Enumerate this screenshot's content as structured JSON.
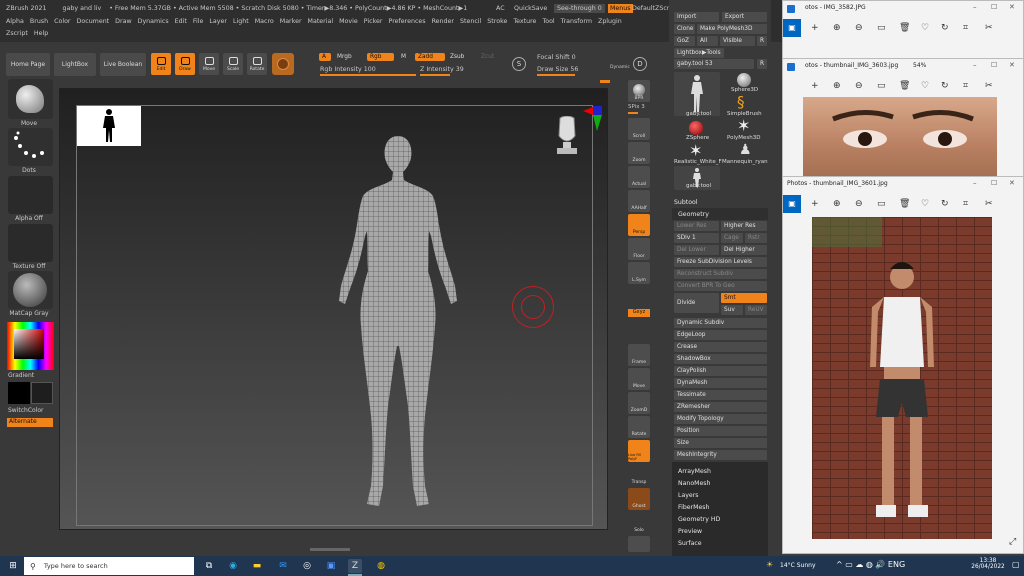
{
  "zbrush": {
    "status_title": "ZBrush 2021",
    "status_project": "gaby and liv",
    "status_mem": "• Free Mem 5.37GB • Active Mem 5508 • Scratch Disk 5080 • Timer▶8.346 • PolyCount▶4.86 KP • MeshCount▶1",
    "ac": "AC",
    "quicksave": "QuickSave",
    "seethrough": "See-through  0",
    "menus": "Menus",
    "defaultzscript": "DefaultZScript",
    "menu_row1": [
      "Alpha",
      "Brush",
      "Color",
      "Document",
      "Draw",
      "Dynamics",
      "Edit",
      "File",
      "Layer",
      "Light",
      "Macro",
      "Marker",
      "Material",
      "Movie",
      "Picker",
      "Preferences",
      "Render",
      "Stencil",
      "Stroke",
      "Texture",
      "Tool",
      "Transform",
      "Zplugin"
    ],
    "menu_row2": [
      "Zscript",
      "Help"
    ],
    "home_page": "Home Page",
    "lightbox": "LightBox",
    "live_boolean": "Live Boolean",
    "tools": {
      "edit": "Edit",
      "draw": "Draw",
      "move": "Move",
      "scale": "Scale",
      "rotate": "Rotate"
    },
    "switches": {
      "a": "A",
      "mrgb": "Mrgb",
      "rgb": "Rgb",
      "m": "M",
      "zadd": "Zadd",
      "zsub": "Zsub",
      "zcut": "Zcut"
    },
    "rgb_intensity": "Rgb Intensity 100",
    "z_intensity": "Z Intensity 39",
    "focal_shift": "Focal Shift 0",
    "draw_size": "Draw Size 56",
    "dynamic": "Dynamic",
    "left": {
      "move": "Move",
      "dots": "Dots",
      "alpha_off": "Alpha Off",
      "texture_off": "Texture Off",
      "matcap_gray": "MatCap Gray",
      "gradient": "Gradient",
      "switchcolor": "SwitchColor",
      "alternate": "Alternate"
    },
    "shelf": [
      "BPR",
      "SPix 3",
      "Scroll",
      "Zoom",
      "Actual",
      "AAHalf",
      "Persp",
      "Floor",
      "L.Sym",
      "Gxyz",
      "Frame",
      "Move",
      "ZoomD",
      "Rotate",
      "Line Fill PolyF",
      "Transp",
      "Ghost",
      "Solo",
      "Xpose"
    ],
    "tray": {
      "import": "Import",
      "export": "Export",
      "clone": "Clone",
      "make_polymesh": "Make PolyMesh3D",
      "goz": "GoZ",
      "all": "All",
      "visible": "Visible",
      "r": "R",
      "lightbox_tools": "Lightbox▶Tools",
      "gaby_tool": "gaby.tool  53",
      "r2": "R",
      "thumbs": [
        "gaby.tool",
        "Sphere3D",
        "SimpleBrush",
        "ZSphere",
        "PolyMesh3D",
        "Realistic_White_F",
        "Mannequin_ryan",
        "gaby.tool"
      ],
      "subtool": "Subtool",
      "geometry": "Geometry",
      "lower_res": "Lower Res",
      "higher_res": "Higher Res",
      "sdiv": "SDiv 1",
      "cage": "Cage",
      "rstr": "Rstr",
      "del_lower": "Del Lower",
      "del_higher": "Del Higher",
      "freeze": "Freeze SubDivision Levels",
      "reconstruct": "Reconstruct Subdiv",
      "convert_bpr": "Convert BPR To Geo",
      "divide": "Divide",
      "smt": "Smt",
      "suv": "Suv",
      "reuv": "ReUV",
      "list": [
        "Dynamic Subdiv",
        "EdgeLoop",
        "Crease",
        "ShadowBox",
        "ClayPolish",
        "DynaMesh",
        "Tessimate",
        "ZRemesher",
        "Modify Topology",
        "Position",
        "Size",
        "MeshIntegrity"
      ],
      "list2": [
        "ArrayMesh",
        "NanoMesh",
        "Layers",
        "FiberMesh",
        "Geometry HD",
        "Preview",
        "Surface"
      ]
    }
  },
  "photos": {
    "win1_title": "otos - IMG_3582.JPG",
    "win2_title": "otos - thumbnail_IMG_3603.jpg",
    "win2_zoom": "54%",
    "win3_title": "Photos - thumbnail_IMG_3601.jpg"
  },
  "taskbar": {
    "search_placeholder": "Type here to search",
    "weather": "14°C  Sunny",
    "time": "13:38",
    "date": "26/04/2022"
  },
  "colors": {
    "accent": "#f0841a",
    "taskbar": "#1f3550",
    "panel": "#393939"
  }
}
